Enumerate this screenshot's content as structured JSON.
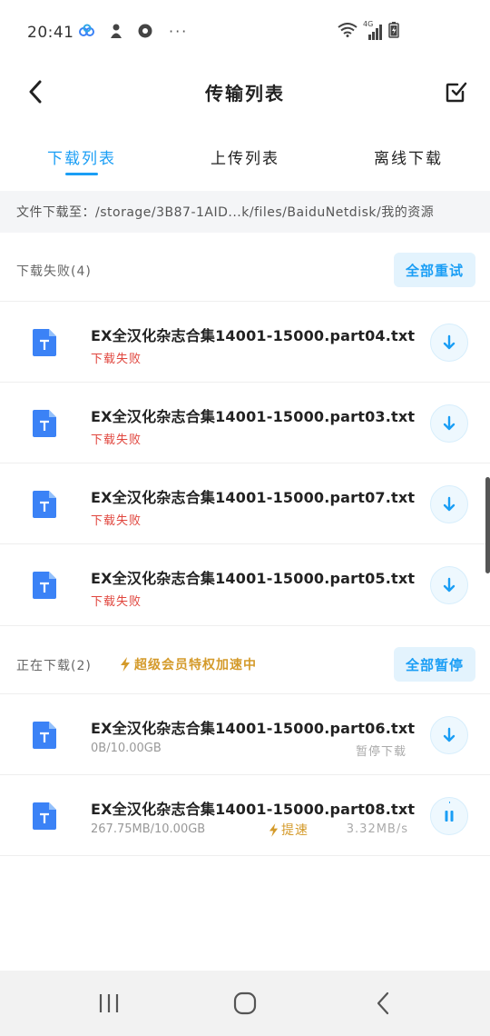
{
  "status_bar": {
    "time": "20:41",
    "dots": "···",
    "network": "4G"
  },
  "header": {
    "title": "传输列表",
    "icons": [
      "back-arrow-icon",
      "multi-select-icon"
    ]
  },
  "tabs": [
    {
      "label": "下载列表",
      "active": true
    },
    {
      "label": "上传列表",
      "active": false
    },
    {
      "label": "离线下载",
      "active": false
    }
  ],
  "path_bar": {
    "text": "文件下载至：/storage/3B87-1AID...k/files/BaiduNetdisk/我的资源"
  },
  "failed_section": {
    "label": "下载失败(4)",
    "button": "全部重试",
    "items": [
      {
        "name": "EX全汉化杂志合集14001-15000.part04.txt",
        "status": "下载失败"
      },
      {
        "name": "EX全汉化杂志合集14001-15000.part03.txt",
        "status": "下载失败"
      },
      {
        "name": "EX全汉化杂志合集14001-15000.part07.txt",
        "status": "下载失败"
      },
      {
        "name": "EX全汉化杂志合集14001-15000.part05.txt",
        "status": "下载失败"
      }
    ]
  },
  "downloading_section": {
    "label": "正在下载(2)",
    "vip_note": "超级会员特权加速中",
    "button": "全部暂停",
    "items": [
      {
        "name": "EX全汉化杂志合集14001-15000.part06.txt",
        "progress": "0B/10.00GB",
        "state": "暂停下载"
      },
      {
        "name": "EX全汉化杂志合集14001-15000.part08.txt",
        "progress": "267.75MB/10.00GB",
        "boost": "提速",
        "speed": "3.32MB/s"
      }
    ]
  },
  "colors": {
    "accent": "#1a9ef5",
    "fail": "#e0453d",
    "vip": "#d49a2a",
    "file_icon": "#3b82f6"
  }
}
